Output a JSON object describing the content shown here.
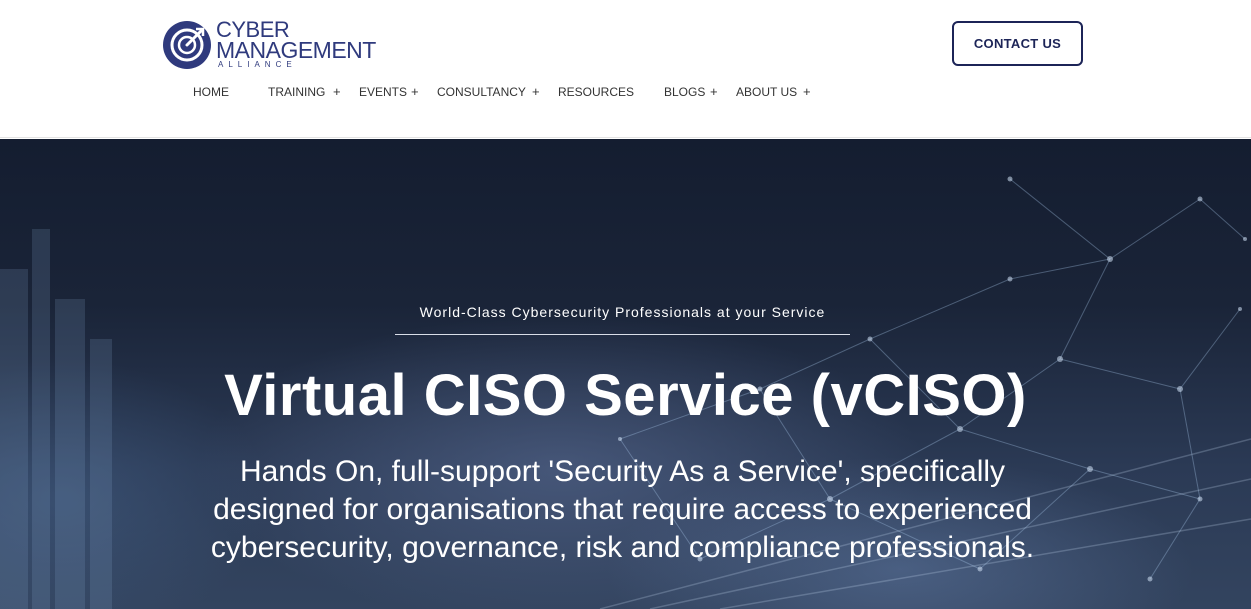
{
  "logo": {
    "line1": "CYBER",
    "line2": "MANAGEMENT",
    "line3": "ALLIANCE",
    "icon": "cyber-management-alliance-logo-icon",
    "brand_color": "#2f3a7d"
  },
  "header": {
    "contact_label": "CONTACT US",
    "contact_color": "#1c2457"
  },
  "nav": {
    "home": "HOME",
    "training": "TRAINING",
    "events": "EVENTS",
    "consultancy": "CONSULTANCY",
    "resources": "RESOURCES",
    "blogs": "BLOGS",
    "about": "ABOUT US",
    "plus": "+"
  },
  "hero": {
    "eyebrow": "World-Class Cybersecurity Professionals at your Service",
    "title": "Virtual CISO Service (vCISO)",
    "subtitle": "Hands On, full-support 'Security As a Service', specifically designed for organisations that require access to experienced cybersecurity, governance, risk and compliance professionals.",
    "background_icon": "network-cityscape-background"
  }
}
